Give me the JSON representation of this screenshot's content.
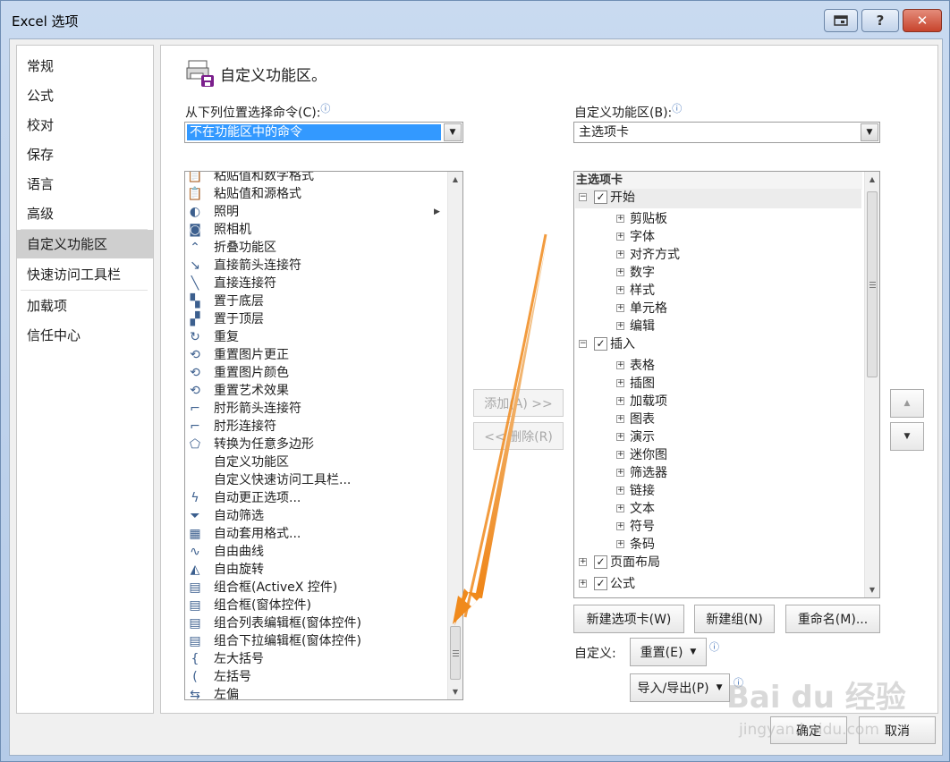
{
  "window": {
    "title": "Excel 选项",
    "restore_icon": "restore-icon",
    "help_label": "?",
    "close_label": "✕"
  },
  "nav": {
    "items": [
      {
        "label": "常规"
      },
      {
        "label": "公式"
      },
      {
        "label": "校对"
      },
      {
        "label": "保存"
      },
      {
        "label": "语言"
      },
      {
        "label": "高级"
      },
      {
        "label": "自定义功能区"
      },
      {
        "label": "快速访问工具栏"
      },
      {
        "label": "加载项"
      },
      {
        "label": "信任中心"
      }
    ],
    "active_index": 6
  },
  "panel": {
    "title": "自定义功能区。",
    "left_label": "从下列位置选择命令(C):",
    "left_combo_value": "不在功能区中的命令",
    "right_label": "自定义功能区(B):",
    "right_combo_value": "主选项卡",
    "commands": [
      {
        "label": "粘贴值和数字格式",
        "icon": "paste-values-number-icon"
      },
      {
        "label": "粘贴值和源格式",
        "icon": "paste-values-source-icon"
      },
      {
        "label": "照明",
        "icon": "lighting-icon",
        "submenu": true
      },
      {
        "label": "照相机",
        "icon": "camera-icon"
      },
      {
        "label": "折叠功能区",
        "icon": "collapse-ribbon-icon"
      },
      {
        "label": "直接箭头连接符",
        "icon": "straight-arrow-connector-icon"
      },
      {
        "label": "直接连接符",
        "icon": "straight-connector-icon"
      },
      {
        "label": "置于底层",
        "icon": "send-to-back-icon"
      },
      {
        "label": "置于顶层",
        "icon": "bring-to-front-icon"
      },
      {
        "label": "重复",
        "icon": "repeat-icon"
      },
      {
        "label": "重置图片更正",
        "icon": "reset-picture-correction-icon"
      },
      {
        "label": "重置图片颜色",
        "icon": "reset-picture-color-icon"
      },
      {
        "label": "重置艺术效果",
        "icon": "reset-artistic-effect-icon"
      },
      {
        "label": "肘形箭头连接符",
        "icon": "elbow-arrow-connector-icon"
      },
      {
        "label": "肘形连接符",
        "icon": "elbow-connector-icon"
      },
      {
        "label": "转换为任意多边形",
        "icon": "convert-freeform-icon"
      },
      {
        "label": "自定义功能区",
        "icon": ""
      },
      {
        "label": "自定义快速访问工具栏...",
        "icon": ""
      },
      {
        "label": "自动更正选项...",
        "icon": "autocorrect-options-icon"
      },
      {
        "label": "自动筛选",
        "icon": "autofilter-icon"
      },
      {
        "label": "自动套用格式...",
        "icon": "autoformat-icon"
      },
      {
        "label": "自由曲线",
        "icon": "freeform-curve-icon"
      },
      {
        "label": "自由旋转",
        "icon": "free-rotate-icon"
      },
      {
        "label": "组合框(ActiveX 控件)",
        "icon": "combo-box-activex-icon"
      },
      {
        "label": "组合框(窗体控件)",
        "icon": "combo-box-form-icon"
      },
      {
        "label": "组合列表编辑框(窗体控件)",
        "icon": "combo-list-edit-icon"
      },
      {
        "label": "组合下拉编辑框(窗体控件)",
        "icon": "combo-dropdown-edit-icon"
      },
      {
        "label": "左大括号",
        "icon": "left-brace-icon"
      },
      {
        "label": "左括号",
        "icon": "left-paren-icon"
      },
      {
        "label": "左偏",
        "icon": "tilt-left-icon"
      }
    ],
    "add_button": "添加(A) >>",
    "remove_button": "<< 删除(R)",
    "tree_header": "主选项卡",
    "tree": [
      {
        "label": "开始",
        "level": 0,
        "checked": true,
        "expanded": true
      },
      {
        "label": "剪贴板",
        "level": 1
      },
      {
        "label": "字体",
        "level": 1
      },
      {
        "label": "对齐方式",
        "level": 1
      },
      {
        "label": "数字",
        "level": 1
      },
      {
        "label": "样式",
        "level": 1
      },
      {
        "label": "单元格",
        "level": 1
      },
      {
        "label": "编辑",
        "level": 1
      },
      {
        "label": "插入",
        "level": 0,
        "checked": true,
        "expanded": true
      },
      {
        "label": "表格",
        "level": 1
      },
      {
        "label": "插图",
        "level": 1
      },
      {
        "label": "加载项",
        "level": 1
      },
      {
        "label": "图表",
        "level": 1
      },
      {
        "label": "演示",
        "level": 1
      },
      {
        "label": "迷你图",
        "level": 1
      },
      {
        "label": "筛选器",
        "level": 1
      },
      {
        "label": "链接",
        "level": 1
      },
      {
        "label": "文本",
        "level": 1
      },
      {
        "label": "符号",
        "level": 1
      },
      {
        "label": "条码",
        "level": 1
      },
      {
        "label": "页面布局",
        "level": 0,
        "checked": true,
        "expanded": false
      },
      {
        "label": "公式",
        "level": 0,
        "checked": true,
        "expanded": false
      }
    ],
    "new_tab_button": "新建选项卡(W)",
    "new_group_button": "新建组(N)",
    "rename_button": "重命名(M)...",
    "customize_label": "自定义:",
    "reset_button": "重置(E)",
    "import_export_button": "导入/导出(P)",
    "move_up_icon": "move-up-icon",
    "move_down_icon": "move-down-icon"
  },
  "footer": {
    "ok_button": "确定",
    "cancel_button": "取消"
  },
  "watermark": {
    "big": "Bai du 经验",
    "small": "jingyan.baidu.com"
  },
  "colors": {
    "selection": "#3399ff",
    "annotation_arrow": "#f08a1c",
    "active_nav": "#cfcfcf"
  }
}
